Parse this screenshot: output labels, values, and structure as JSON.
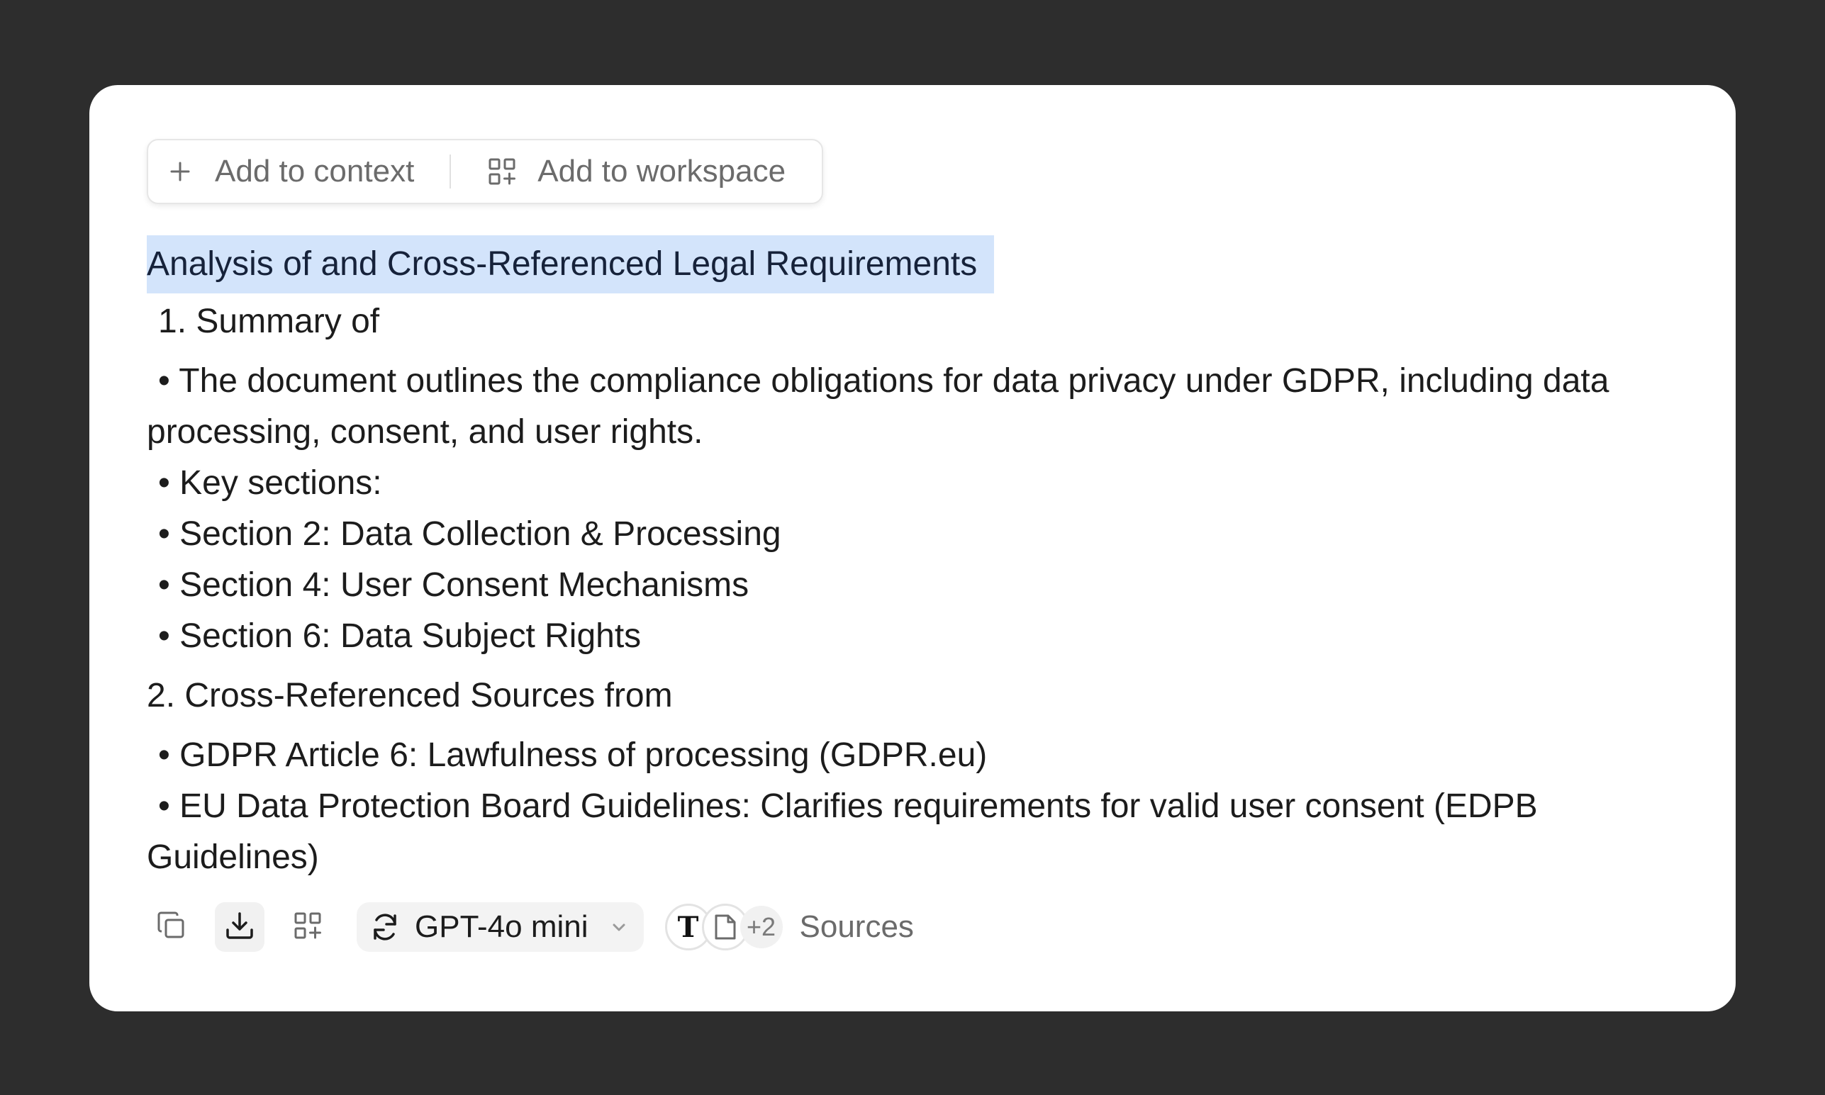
{
  "toolbar": {
    "add_to_context": "Add to context",
    "add_to_workspace": "Add to workspace"
  },
  "document": {
    "heading": "Analysis of and Cross-Referenced Legal Requirements",
    "section1_title": "1. Summary of",
    "bullet_overview": "• The document outlines the compliance obligations for data privacy under GDPR, including data processing, consent, and user rights.",
    "bullet_key_sections": "• Key sections:",
    "bullet_section2": "• Section 2: Data Collection & Processing",
    "bullet_section4": "• Section 4: User Consent Mechanisms",
    "bullet_section6": "• Section 6: Data Subject Rights",
    "section2_title": "2. Cross-Referenced Sources from",
    "bullet_gdpr": "• GDPR Article 6: Lawfulness of processing (GDPR.eu)",
    "bullet_edpb": "• EU Data Protection Board Guidelines: Clarifies requirements for valid user consent (EDPB Guidelines)"
  },
  "footer": {
    "model_name": "GPT-4o mini",
    "source_icon_1": "T",
    "sources_more": "+2",
    "sources_label": "Sources"
  },
  "icons": {
    "copy": "copy-icon",
    "download": "download-icon",
    "workspace": "add-to-workspace-icon",
    "regenerate": "refresh-icon",
    "chevron": "chevron-down-icon",
    "document": "document-icon"
  },
  "colors": {
    "background": "#2d2d2d",
    "card": "#ffffff",
    "highlight": "#d3e4fb"
  }
}
